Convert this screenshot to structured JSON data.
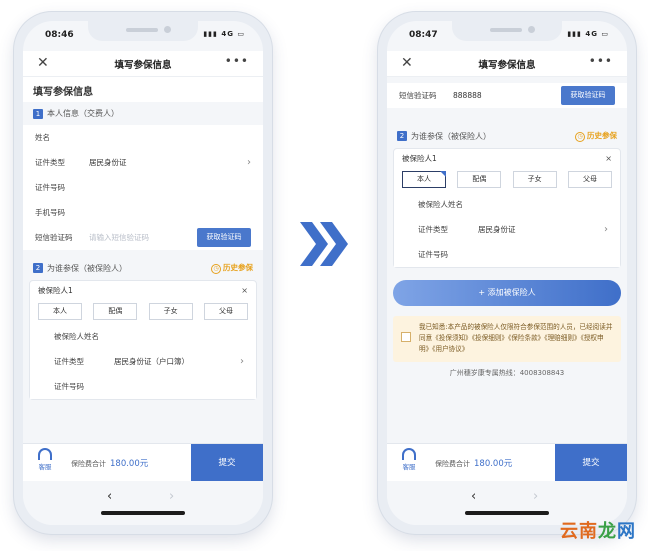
{
  "left_phone": {
    "status": {
      "time": "08:46",
      "icons": "▮▮▮ 4G ▭"
    },
    "nav": {
      "title": "填写参保信息",
      "close": "✕",
      "more": "•••"
    },
    "page_heading": "填写参保信息",
    "section1": {
      "num": "1",
      "title": "本人信息（交费人）",
      "name_label": "姓名",
      "id_type_label": "证件类型",
      "id_type_value": "居民身份证",
      "id_number_label": "证件号码",
      "phone_label": "手机号码",
      "sms_label": "短信验证码",
      "sms_placeholder": "请输入短信验证码",
      "sms_button": "获取验证码"
    },
    "section2": {
      "num": "2",
      "title": "为谁参保（被保险人）",
      "history": "历史参保",
      "insured_title": "被保险人1",
      "close": "×",
      "relations": [
        "本人",
        "配偶",
        "子女",
        "父母"
      ],
      "name_label": "被保险人姓名",
      "id_type_label": "证件类型",
      "id_type_value": "居民身份证（户口簿）",
      "id_number_label": "证件号码"
    },
    "bottom": {
      "service": "客服",
      "total_label": "保险费合计",
      "total_value": "180.00元",
      "submit": "提交"
    }
  },
  "right_phone": {
    "status": {
      "time": "08:47",
      "icons": "▮▮▮ 4G ▭"
    },
    "nav": {
      "title": "填写参保信息",
      "close": "✕",
      "more": "•••"
    },
    "sms_label": "短信验证码",
    "sms_value": "888888",
    "sms_button": "获取验证码",
    "section2": {
      "num": "2",
      "title": "为谁参保（被保险人）",
      "history": "历史参保",
      "insured_title": "被保险人1",
      "close": "×",
      "relations": [
        "本人",
        "配偶",
        "子女",
        "父母"
      ],
      "name_label": "被保险人姓名",
      "id_type_label": "证件类型",
      "id_type_value": "居民身份证",
      "id_number_label": "证件号码"
    },
    "add_button": "+ 添加被保险人",
    "notice": "我已知悉:本产品的被保险人仅限符合参保范围的人员，已经阅读并同意《投保须知》《投保细则》《保险条款》《理赔细则》《授权申明》《用户协议》",
    "hotline": "广州穗岁康专属热线：4008308843",
    "bottom": {
      "service": "客服",
      "total_label": "保险费合计",
      "total_value": "180.00元",
      "submit": "提交"
    }
  },
  "arrow_icon": "double-chevron-right-icon",
  "watermark": {
    "part1": "云南",
    "part2": "龙",
    "part3": "网"
  },
  "colors": {
    "primary": "#3f6fc9",
    "accent": "#e7a11c",
    "notice_bg": "#fdf3df"
  }
}
